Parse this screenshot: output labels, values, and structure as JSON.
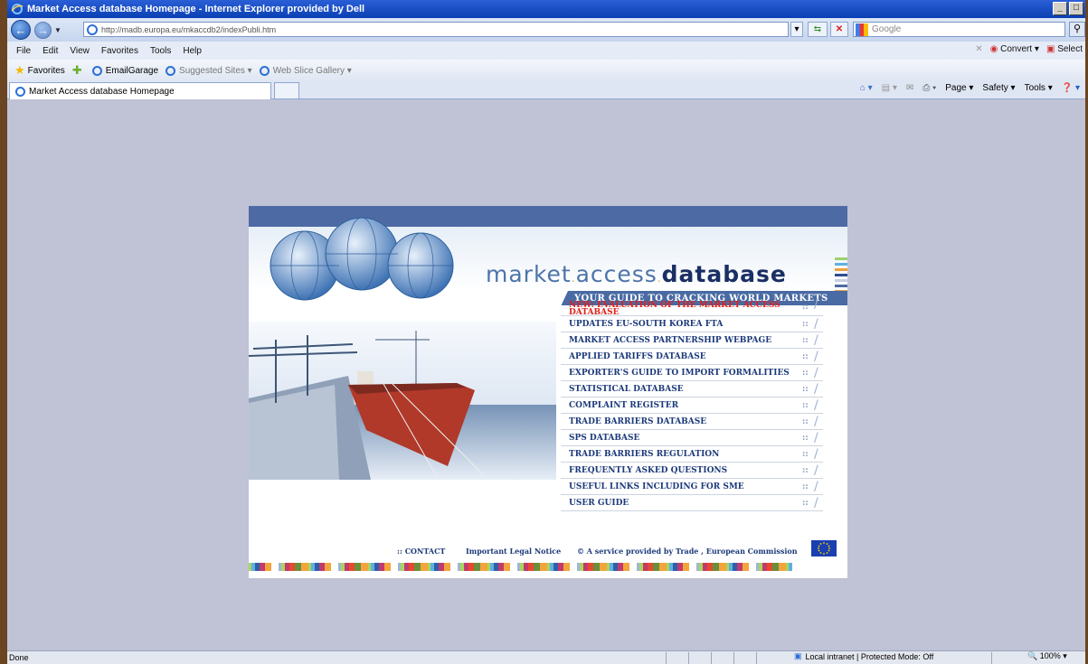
{
  "window": {
    "title": "Market Access database Homepage - Internet Explorer provided by Dell",
    "controls": [
      "_",
      "□"
    ]
  },
  "address_bar": {
    "url": "http://madb.europa.eu/mkaccdb2/indexPubli.htm",
    "search_placeholder": "Google"
  },
  "menu_bar": {
    "items": [
      "File",
      "Edit",
      "View",
      "Favorites",
      "Tools",
      "Help"
    ],
    "convert_label": "Convert",
    "select_label": "Select"
  },
  "favorites_bar": {
    "favorites_label": "Favorites",
    "items": [
      "EmailGarage",
      "Suggested Sites",
      "Web Slice Gallery"
    ]
  },
  "tab": {
    "title": "Market Access database Homepage"
  },
  "command_bar": {
    "items": [
      "Page",
      "Safety",
      "Tools"
    ]
  },
  "page": {
    "logo_parts": [
      "market",
      "access",
      "database"
    ],
    "tagline": "YOUR GUIDE TO CRACKING WORLD MARKETS",
    "menu": [
      {
        "label": "NEW: EVALUATION OF THE MARKET ACCESS DATABASE",
        "is_new": true
      },
      {
        "label": "UPDATES EU-SOUTH KOREA FTA"
      },
      {
        "label": "MARKET ACCESS PARTNERSHIP WEBPAGE"
      },
      {
        "label": "APPLIED TARIFFS DATABASE"
      },
      {
        "label": "EXPORTER'S GUIDE TO IMPORT FORMALITIES"
      },
      {
        "label": "STATISTICAL DATABASE"
      },
      {
        "label": "COMPLAINT REGISTER"
      },
      {
        "label": "TRADE BARRIERS DATABASE"
      },
      {
        "label": "SPS DATABASE"
      },
      {
        "label": "TRADE BARRIERS REGULATION"
      },
      {
        "label": "FREQUENTLY ASKED QUESTIONS"
      },
      {
        "label": "USEFUL LINKS INCLUDING FOR SME"
      },
      {
        "label": "USER GUIDE"
      }
    ],
    "menu_marker": "::",
    "footer": {
      "contact": ":: CONTACT",
      "legal": "Important Legal Notice",
      "service": "© A service provided by Trade , European Commission"
    }
  },
  "status_bar": {
    "status": "Done",
    "zone": "Local intranet | Protected Mode: Off",
    "zoom": "100%"
  }
}
